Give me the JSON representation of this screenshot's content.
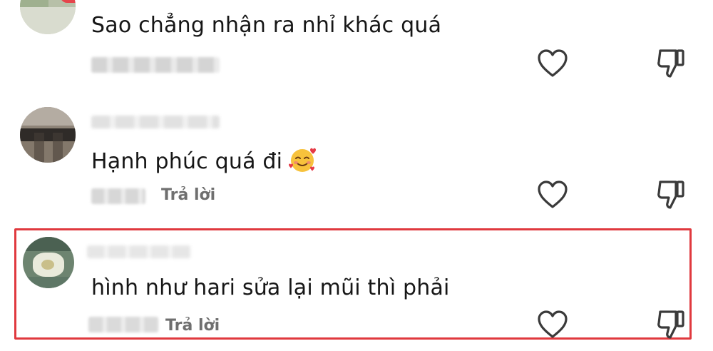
{
  "comments": [
    {
      "text": "Sao chẳng nhận ra nhỉ khác quá",
      "reply_label": "",
      "avatar": "avatar-red-accent"
    },
    {
      "text": "Hạnh phúc quá đi",
      "emoji": "smiling-face-with-hearts",
      "reply_label": "Trả lời",
      "avatar": "avatar-photo"
    },
    {
      "text": "hình như hari sửa lại mũi thì phải",
      "reply_label": "Trả lời",
      "avatar": "avatar-green",
      "highlighted": true
    }
  ],
  "icons": {
    "like": "heart-outline-icon",
    "dislike": "thumbs-down-outline-icon"
  },
  "colors": {
    "highlight_border": "#e0393e",
    "text": "#161616",
    "muted": "#6f6f6f",
    "icon": "#3a3a3a"
  }
}
